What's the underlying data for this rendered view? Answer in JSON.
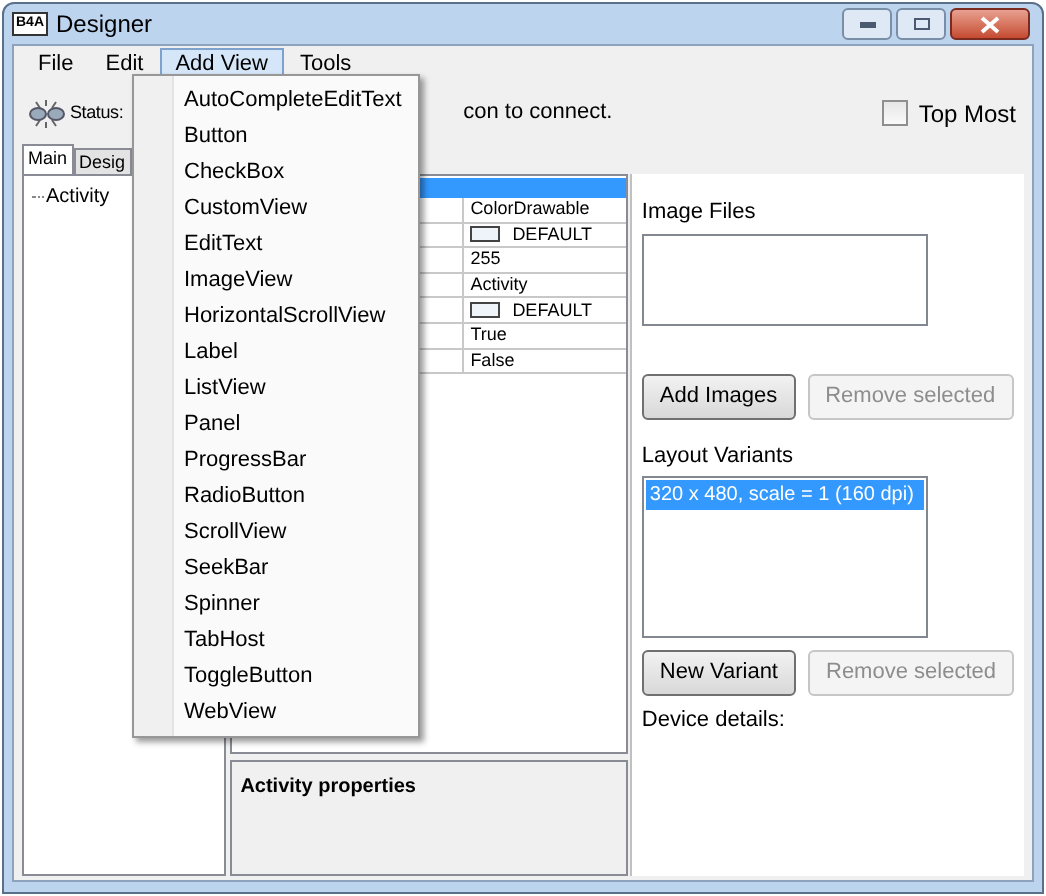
{
  "window": {
    "logo": "B4A",
    "title": "Designer"
  },
  "menu_bar": [
    {
      "label": "File",
      "selected": false
    },
    {
      "label": "Edit",
      "selected": false
    },
    {
      "label": "Add View",
      "selected": true
    },
    {
      "label": "Tools",
      "selected": false
    }
  ],
  "status": {
    "label": "Status:",
    "message": "con to connect."
  },
  "top_most": {
    "label": "Top Most",
    "checked": false
  },
  "tabs": [
    {
      "label": "Main",
      "selected": true
    },
    {
      "label": "Desig",
      "selected": false
    }
  ],
  "tree": [
    {
      "label": "Activity"
    }
  ],
  "properties": {
    "rows": [
      {
        "kind": "text",
        "value": "ColorDrawable"
      },
      {
        "kind": "color",
        "value": "DEFAULT"
      },
      {
        "kind": "text",
        "value": "255"
      },
      {
        "kind": "text",
        "value": "Activity"
      },
      {
        "kind": "color",
        "value": "DEFAULT"
      },
      {
        "kind": "text",
        "value": "True"
      },
      {
        "kind": "text",
        "value": "False"
      }
    ]
  },
  "properties_description": {
    "title": "Activity properties"
  },
  "image_files": {
    "label": "Image Files",
    "buttons": [
      {
        "label": "Add Images",
        "disabled": false
      },
      {
        "label": "Remove selected",
        "disabled": true
      }
    ]
  },
  "layout_variants": {
    "label": "Layout Variants",
    "items": [
      {
        "label": "320 x 480, scale = 1 (160 dpi)",
        "selected": true
      }
    ],
    "buttons": [
      {
        "label": "New Variant",
        "disabled": false
      },
      {
        "label": "Remove selected",
        "disabled": true
      }
    ]
  },
  "device_details": {
    "label": "Device details:"
  },
  "add_view_menu": {
    "items": [
      "AutoCompleteEditText",
      "Button",
      "CheckBox",
      "CustomView",
      "EditText",
      "ImageView",
      "HorizontalScrollView",
      "Label",
      "ListView",
      "Panel",
      "ProgressBar",
      "RadioButton",
      "ScrollView",
      "SeekBar",
      "Spinner",
      "TabHost",
      "ToggleButton",
      "WebView"
    ]
  }
}
